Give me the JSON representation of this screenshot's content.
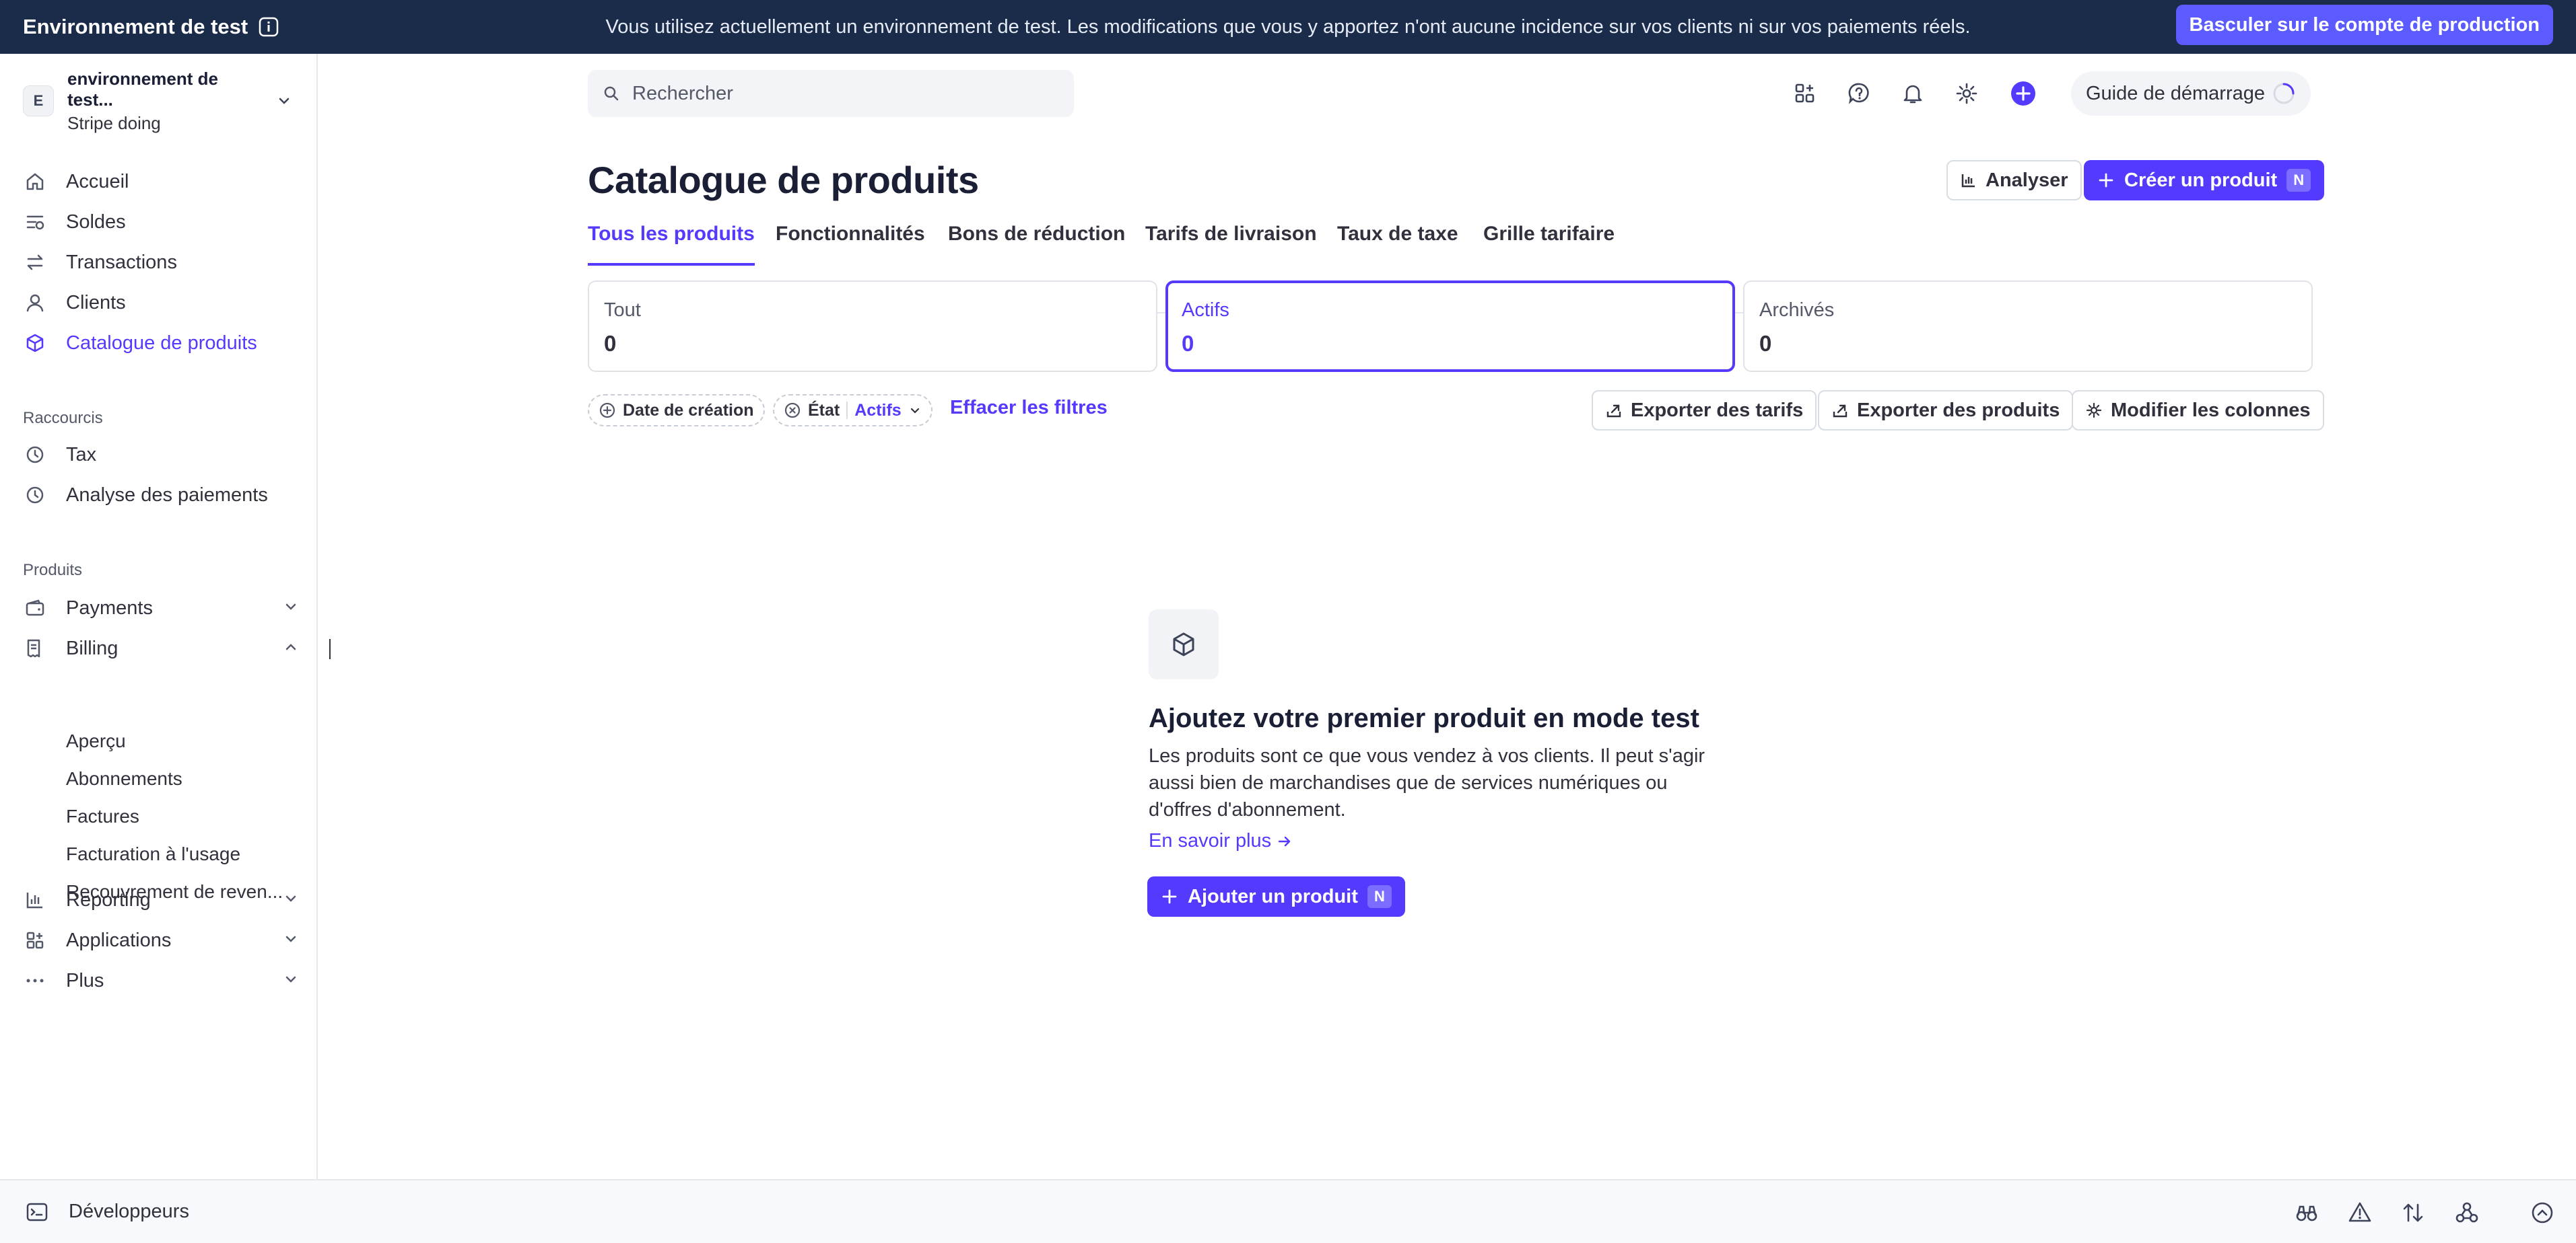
{
  "banner": {
    "title": "Environnement de test",
    "message": "Vous utilisez actuellement un environnement de test. Les modifications que vous y apportez n'ont aucune incidence sur vos clients ni sur vos paiements réels.",
    "button": "Basculer sur le compte de production"
  },
  "account": {
    "initial": "E",
    "name": "environnement de test...",
    "sub": "Stripe doing"
  },
  "nav": {
    "main": [
      {
        "label": "Accueil",
        "icon": "home-icon"
      },
      {
        "label": "Soldes",
        "icon": "balances-icon"
      },
      {
        "label": "Transactions",
        "icon": "transactions-icon"
      },
      {
        "label": "Clients",
        "icon": "person-icon"
      },
      {
        "label": "Catalogue de produits",
        "icon": "box-icon"
      }
    ],
    "shortcuts_label": "Raccourcis",
    "shortcuts": [
      {
        "label": "Tax",
        "icon": "clock-icon"
      },
      {
        "label": "Analyse des paiements",
        "icon": "clock-icon"
      }
    ],
    "products_label": "Produits",
    "products": [
      {
        "label": "Payments",
        "icon": "wallet-icon"
      },
      {
        "label": "Billing",
        "icon": "billing-icon"
      }
    ],
    "billing_sub": [
      "Aperçu",
      "Abonnements",
      "Factures",
      "Facturation à l'usage",
      "Recouvrement de reven..."
    ],
    "more": [
      {
        "label": "Reporting",
        "icon": "chart-icon"
      },
      {
        "label": "Applications",
        "icon": "apps-icon"
      },
      {
        "label": "Plus",
        "icon": "more-icon"
      }
    ]
  },
  "bottom": {
    "developers": "Développeurs"
  },
  "header": {
    "search_placeholder": "Rechercher",
    "guide": "Guide de démarrage"
  },
  "page": {
    "title": "Catalogue de produits",
    "analyze": "Analyser",
    "create": "Créer un produit",
    "create_kbd": "N"
  },
  "tabs": [
    "Tous les produits",
    "Fonctionnalités",
    "Bons de réduction",
    "Tarifs de livraison",
    "Taux de taxe",
    "Grille tarifaire"
  ],
  "stats": [
    {
      "label": "Tout",
      "value": "0"
    },
    {
      "label": "Actifs",
      "value": "0"
    },
    {
      "label": "Archivés",
      "value": "0"
    }
  ],
  "filters": {
    "date": "Date de création",
    "state": "État",
    "state_value": "Actifs",
    "clear": "Effacer les filtres",
    "export_prices": "Exporter des tarifs",
    "export_products": "Exporter des produits",
    "edit_columns": "Modifier les colonnes"
  },
  "empty": {
    "title": "Ajoutez votre premier produit en mode test",
    "description": "Les produits sont ce que vous vendez à vos clients. Il peut s'agir aussi bien de marchandises que de services numériques ou d'offres d'abonnement.",
    "learn_more": "En savoir plus",
    "add_button": "Ajouter un produit",
    "add_kbd": "N"
  },
  "colors": {
    "accent": "#533afd",
    "banner": "#1b2c4a",
    "banner_button": "#5b5bff"
  }
}
